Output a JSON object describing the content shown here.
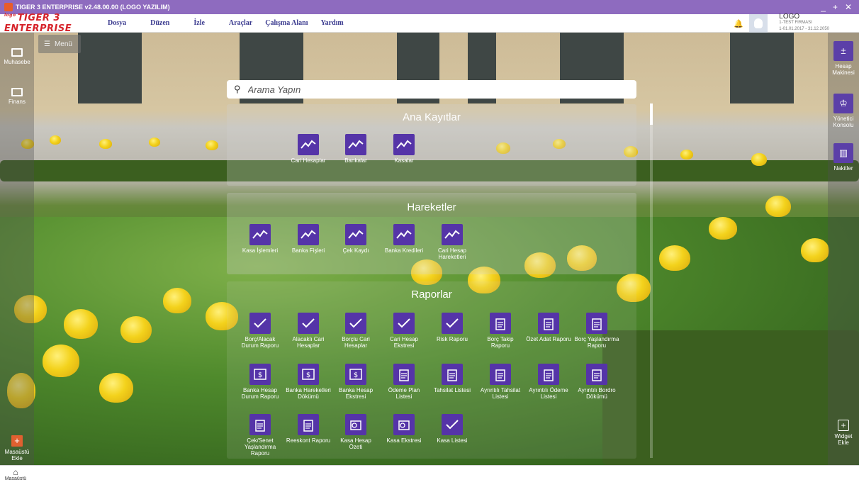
{
  "window": {
    "title": "TIGER 3 ENTERPRISE v2.48.00.00 (LOGO YAZILIM)",
    "controls": [
      "_",
      "+",
      "✕"
    ]
  },
  "menubar": {
    "brand_prefix": "logo",
    "brand": "TIGER 3 ENTERPRISE",
    "items": [
      "Dosya",
      "Düzen",
      "İzle",
      "Araçlar",
      "Çalışma Alanı",
      "Yardım"
    ],
    "company": {
      "name": "LOGO",
      "line2": "1-TEST FIRMASI",
      "line3": "1-01.01.2017 - 31.12.2050"
    }
  },
  "left_sidebar": {
    "items": [
      "Muhasebe",
      "Finans"
    ],
    "add_label": "Masaüstü Ekle"
  },
  "right_sidebar": {
    "items": [
      "Hesap Makinesi",
      "Yönetici Konsolu",
      "Nakitler"
    ],
    "widget_label": "Widget Ekle"
  },
  "menu_button": {
    "label": "Menü"
  },
  "search": {
    "placeholder": "Arama Yapın"
  },
  "sections": {
    "ana_kayitlar": {
      "title": "Ana Kayıtlar",
      "tiles": [
        "Cari Hesaplar",
        "Bankalar",
        "Kasalar"
      ]
    },
    "hareketler": {
      "title": "Hareketler",
      "tiles": [
        "Kasa İşlemleri",
        "Banka Fişleri",
        "Çek Kaydı",
        "Banka Kredileri",
        "Cari Hesap Hareketleri"
      ]
    },
    "raporlar": {
      "title": "Raporlar",
      "tiles": [
        "Borç/Alacak Durum Raporu",
        "Alacaklı Cari Hesaplar",
        "Borçlu Cari Hesaplar",
        "Cari Hesap Ekstresi",
        "Risk Raporu",
        "Borç Takip Raporu",
        "Özet Adat Raporu",
        "Borç Yaşlandırma Raporu",
        "Banka Hesap Durum Raporu",
        "Banka Hareketleri Dökümü",
        "Banka Hesap Ekstresi",
        "Ödeme Plan Listesi",
        "Tahsilat Listesi",
        "Ayrıntılı Tahsilat Listesi",
        "Ayrıntılı Ödeme Listesi",
        "Ayrıntılı Bordro Dökümü",
        "Çek/Senet Yaşlandırma Raporu",
        "Reeskont Raporu",
        "Kasa Hesap Özeti",
        "Kasa Ekstresi",
        "Kasa Listesi"
      ]
    }
  },
  "bottombar": {
    "home_label": "Masaüstü"
  },
  "colors": {
    "titlebar": "#8e6bbf",
    "tile_icon": "#5534a8",
    "brand": "#d6232a"
  }
}
